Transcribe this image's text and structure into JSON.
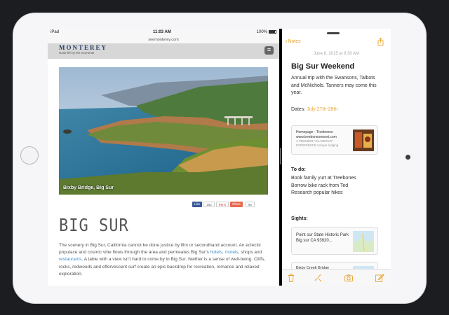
{
  "status_bar": {
    "device": "iPad",
    "time": "11:03 AM",
    "battery": "100%"
  },
  "safari": {
    "url": "seemonterey.com",
    "site_logo": "MONTEREY",
    "site_tagline": "Grab life by the moments",
    "hero_caption": "Bixby Bridge, Big Sur",
    "share": {
      "like": "Like",
      "like_count": "182",
      "pin": "Pin it",
      "share": "Share",
      "share_count": "95"
    },
    "article_title": "BIG SUR",
    "article_body": {
      "p1": "The scenery in Big Sur, California cannot be done justice by film or secondhand account. An eclectic populace and cosmic vibe flows through the area and permeates Big Sur's ",
      "link_hotels": "hotels",
      "sep1": ", ",
      "link_motels": "motels",
      "sep2": ", shops and ",
      "link_restaurants": "restaurants",
      "p2": ". A table with a view isn't hard to come by in Big Sur. Neither is a sense of well-being. Cliffs, rocks, redwoods and effervescent surf create an epic backdrop for recreation, romance and relaxed exploration."
    }
  },
  "notes": {
    "back_label": "Notes",
    "date": "June 8, 2015 at 9:30 AM",
    "title": "Big Sur Weekend",
    "intro": "Annual trip with the Swansons, Talbots and McNichols. Tanners may come this year.",
    "dates_label": "Dates: ",
    "dates_value": "July 27th-28th",
    "link_card": {
      "title": "Homepage - Treebones www.treebonesresort.com",
      "subtitle": "A PREMIER \"GLAMPING\" EXPERIENCE Unique lodging"
    },
    "todo_heading": "To do:",
    "todo_items": [
      "Book family yurt at Treebones",
      "Borrow bike rack from Ted",
      "Research popular hikes"
    ],
    "sights_heading": "Sights:",
    "sight_card": {
      "name": "Point sur State Historic Park",
      "address": "Big sur CA 93920..."
    },
    "sight_card2": {
      "name": "Bixby Creek Bridge"
    }
  },
  "colors": {
    "notes_accent": "#e9a32b",
    "link_blue": "#3a8fcf",
    "facebook": "#3b5998"
  }
}
